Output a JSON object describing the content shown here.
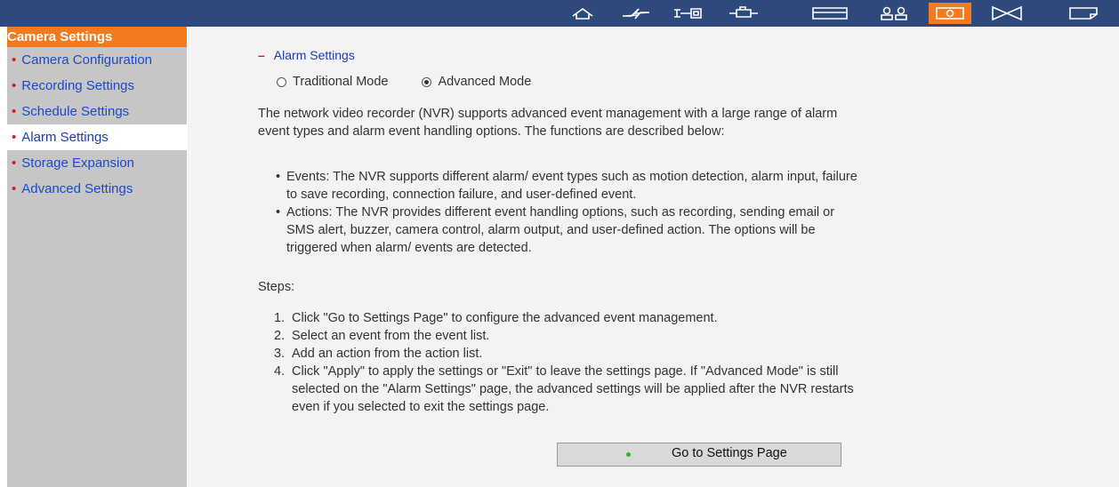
{
  "topbar": {
    "icons": [
      "home-icon",
      "wizard-icon",
      "network-icon",
      "device-icon",
      "storage-icon",
      "users-icon",
      "camera-icon",
      "event-icon",
      "log-icon"
    ],
    "active_color": "#f47a20",
    "bar_color": "#2e4a7d"
  },
  "sidebar": {
    "title": "Camera Settings",
    "items": [
      {
        "label": "Camera Configuration"
      },
      {
        "label": "Recording Settings"
      },
      {
        "label": "Schedule Settings"
      },
      {
        "label": "Alarm Settings"
      },
      {
        "label": "Storage Expansion"
      },
      {
        "label": "Advanced Settings"
      }
    ],
    "active_item": "Alarm Settings"
  },
  "main": {
    "section_title": "Alarm Settings",
    "modes": [
      {
        "label": "Traditional Mode",
        "selected": false
      },
      {
        "label": "Advanced Mode",
        "selected": true
      }
    ],
    "intro": "The network video recorder (NVR) supports advanced event management with a large range of alarm event types and alarm event handling options. The functions are described below:",
    "bullets": [
      "Events: The NVR supports different alarm/ event types such as motion detection, alarm input, failure to save recording, connection failure, and user-defined event.",
      "Actions: The NVR provides different event handling options, such as recording, sending email or SMS alert, buzzer, camera control, alarm output, and user-defined action. The options will be triggered when alarm/ events are detected."
    ],
    "steps_label": "Steps:",
    "steps": [
      {
        "num": "1.",
        "text": "Click \"Go to Settings Page\" to configure the advanced event management."
      },
      {
        "num": "2.",
        "text": "Select an event from the event list."
      },
      {
        "num": "3.",
        "text": "Add an action from the action list."
      },
      {
        "num": "4.",
        "text": "Click \"Apply\" to apply the settings or \"Exit\" to leave the settings page. If \"Advanced Mode\" is still selected on the \"Alarm Settings\" page, the advanced settings will be applied after the NVR restarts even if you selected to exit the settings page."
      }
    ],
    "go_button": "Go to Settings Page"
  }
}
